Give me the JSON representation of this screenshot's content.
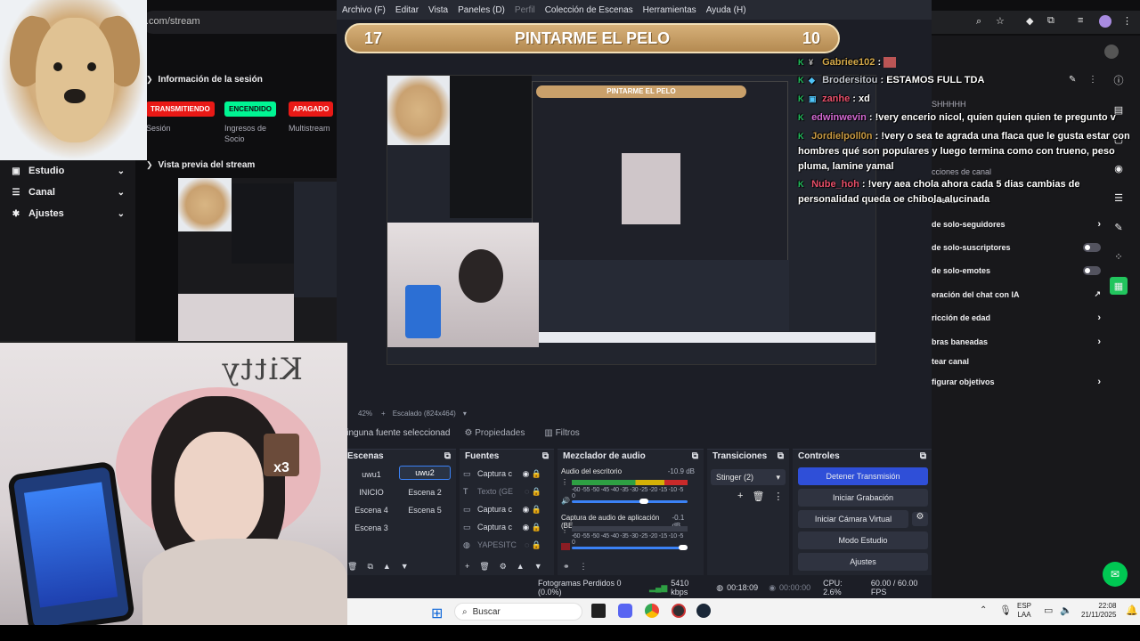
{
  "twitch": {
    "url": ".com/stream",
    "session_title": "Información de la sesión",
    "badges": [
      {
        "label": "TRANSMITIENDO",
        "color": "#e91916",
        "caption": "Sesión"
      },
      {
        "label": "ENCENDIDO",
        "color": "#00f593",
        "caption": "Ingresos de Socio"
      },
      {
        "label": "APAGADO",
        "color": "#e91916",
        "caption": "Multistream"
      }
    ],
    "preview_title": "Vista previa del stream",
    "nav": [
      {
        "label": "Estudio",
        "icon": "video-camera-icon"
      },
      {
        "label": "Canal",
        "icon": "list-icon"
      },
      {
        "label": "Ajustes",
        "icon": "gear-icon"
      }
    ],
    "right_panel": {
      "header_fragment": "SHHHHH",
      "section": "cciones de canal",
      "rows": [
        {
          "label": "o lento",
          "control": "none"
        },
        {
          "label": "de solo-seguidores",
          "control": "chevron"
        },
        {
          "label": "de solo-suscriptores",
          "control": "toggle"
        },
        {
          "label": "de solo-emotes",
          "control": "toggle"
        },
        {
          "label": "eración del chat con IA",
          "control": "external"
        },
        {
          "label": "ricción de edad",
          "control": "chevron"
        },
        {
          "label": "bras baneadas",
          "control": "chevron"
        },
        {
          "label": "tear canal",
          "control": "none"
        },
        {
          "label": "figurar objetivos",
          "control": "chevron"
        }
      ]
    }
  },
  "obs": {
    "menu": [
      {
        "label": "Archivo (F)",
        "dim": false
      },
      {
        "label": "Editar",
        "dim": false
      },
      {
        "label": "Vista",
        "dim": false
      },
      {
        "label": "Paneles (D)",
        "dim": false
      },
      {
        "label": "Perfil",
        "dim": true
      },
      {
        "label": "Colección de Escenas",
        "dim": false
      },
      {
        "label": "Herramientas",
        "dim": false
      },
      {
        "label": "Ayuda (H)",
        "dim": false
      }
    ],
    "banner": {
      "left_num": "17",
      "title": "PINTARME EL PELO",
      "right_num": "10"
    },
    "zoom": "42%",
    "scaling": "Escalado (824x464)",
    "source_selected": "Ninguna fuente seleccionad",
    "props_label": "Propiedades",
    "filters_label": "Filtros",
    "docks": {
      "scenes": "Escenas",
      "sources": "Fuentes",
      "mixer": "Mezclador de audio",
      "transitions": "Transiciones",
      "controls": "Controles"
    },
    "scenes": [
      "uwu1",
      "uwu2",
      "INICIO",
      "Escena 2",
      "Escena 4",
      "Escena 5",
      "Escena 3"
    ],
    "active_scene": "uwu2",
    "sources": [
      {
        "label": "Captura c",
        "icon": "monitor-icon",
        "dim": false
      },
      {
        "label": "Texto (GE",
        "icon": "text-icon",
        "dim": true
      },
      {
        "label": "Captura c",
        "icon": "monitor-icon",
        "dim": false
      },
      {
        "label": "Captura c",
        "icon": "monitor-icon",
        "dim": false
      },
      {
        "label": "YAPESITC",
        "icon": "browser-icon",
        "dim": true
      }
    ],
    "mixer": [
      {
        "name": "Audio del escritorio",
        "db": "-10.9 dB"
      },
      {
        "name": "Captura de audio de aplicación (BE",
        "db": "-0.1 dB"
      }
    ],
    "meter_scale": "-60 -55 -50 -45 -40 -35 -30 -25 -20 -15 -10 -5 0",
    "transition": "Stinger (2)",
    "controls": [
      "Detener Transmisión",
      "Iniciar Grabación",
      "Iniciar Cámara Virtual",
      "Modo Estudio",
      "Ajustes"
    ],
    "status": {
      "dropped": "Fotogramas Perdidos 0 (0.0%)",
      "bitrate": "5410 kbps",
      "live_time": "00:18:09",
      "rec_time": "00:00:00",
      "cpu": "CPU: 2.6%",
      "fps": "60.00 / 60.00 FPS"
    }
  },
  "chat": [
    {
      "user": "Gabriee102",
      "user_color": "#d4a94a",
      "text": ""
    },
    {
      "user": "Brodersitou",
      "user_color": "#c0c4cc",
      "text": "ESTAMOS FULL TDA"
    },
    {
      "user": "zanhe",
      "user_color": "#e84f6a",
      "text": "xd"
    },
    {
      "user": "edwinwevin",
      "user_color": "#d46ad4",
      "text": "!very encerio nicol, quien quien quien te pregunto v"
    },
    {
      "user": "Jordielpoll0n",
      "user_color": "#c99a42",
      "text": "!very o sea te agrada una flaca que le gusta estar con hombres qué son populares y luego termina como con trueno, peso pluma, lamine yamal"
    },
    {
      "user": "Nube_hoh",
      "user_color": "#e84f6a",
      "text": "!very aea chola ahora cada 5 dias cambias de personalidad queda oe chibola alucinada"
    }
  ],
  "taskbar": {
    "search_placeholder": "Buscar",
    "lang": "ESP",
    "lang_sub": "LAA",
    "time": "22:08",
    "date": "21/11/2025"
  },
  "cam_overlay_text": "x3"
}
